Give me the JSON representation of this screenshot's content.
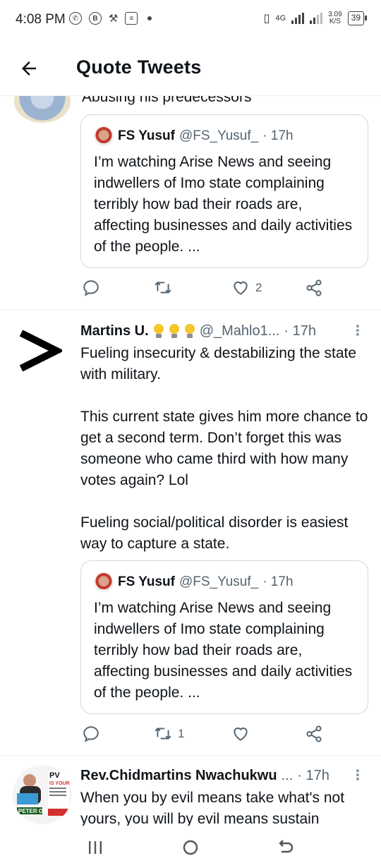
{
  "status_bar": {
    "time": "4:08 PM",
    "network": "4G",
    "speed_top": "3.09",
    "speed_bottom": "K/S",
    "battery": "39"
  },
  "header": {
    "title": "Quote Tweets",
    "back_icon": "arrow-left-icon"
  },
  "partial_tweet": {
    "clipped_text": "Abusing his predecessors"
  },
  "quoted_tweet": {
    "name": "FS Yusuf",
    "handle": "@FS_Yusuf_",
    "time": "· 17h",
    "text": "I’m watching Arise News and seeing indwellers of Imo state complaining terribly how bad their roads are, affecting businesses and daily activities of the people. ..."
  },
  "tweets": [
    {
      "actions": {
        "reply": "",
        "retweet": "",
        "like": "2",
        "share": ""
      }
    },
    {
      "name": "Martins U.",
      "handle": "@_Mahlo1...",
      "time": "· 17h",
      "paragraphs": [
        "Fueling insecurity & destabilizing the state with military.",
        "This current state gives him more chance to get a second term. Don’t forget this was someone who came third with how many votes again? Lol",
        "Fueling social/political disorder is easiest way to capture a state."
      ],
      "actions": {
        "reply": "",
        "retweet": "1",
        "like": "",
        "share": ""
      }
    },
    {
      "name": "Rev.Chidmartins Nwachukwu",
      "handle": "...",
      "time": "· 17h",
      "text": "When you by evil means take what's not yours, you will by evil means sustain"
    }
  ],
  "avatar_text": {
    "brand": "PV",
    "slogan": "IS YOUR",
    "name": "PETER OBI"
  },
  "colors": {
    "text": "#0f1419",
    "muted": "#536471",
    "border": "#cfd9de"
  }
}
